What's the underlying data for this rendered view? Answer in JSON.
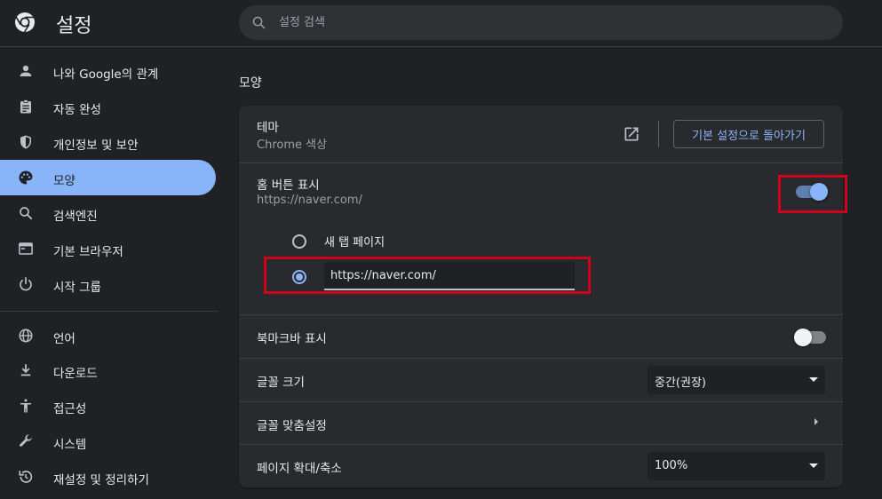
{
  "header": {
    "title": "설정",
    "search_placeholder": "설정 검색"
  },
  "sidebar": {
    "items": [
      {
        "label": "나와 Google의 관계",
        "icon": "person-icon"
      },
      {
        "label": "자동 완성",
        "icon": "clipboard-icon"
      },
      {
        "label": "개인정보 및 보안",
        "icon": "shield-icon"
      },
      {
        "label": "모양",
        "icon": "palette-icon",
        "active": true
      },
      {
        "label": "검색엔진",
        "icon": "search-icon"
      },
      {
        "label": "기본 브라우저",
        "icon": "browser-window-icon"
      },
      {
        "label": "시작 그룹",
        "icon": "power-icon"
      },
      {
        "label": "언어",
        "icon": "globe-icon"
      },
      {
        "label": "다운로드",
        "icon": "download-icon"
      },
      {
        "label": "접근성",
        "icon": "accessibility-icon"
      },
      {
        "label": "시스템",
        "icon": "wrench-icon"
      },
      {
        "label": "재설정 및 정리하기",
        "icon": "history-reset-icon"
      }
    ]
  },
  "main": {
    "section_title": "모양",
    "theme": {
      "title": "테마",
      "subtitle": "Chrome 색상",
      "reset_button": "기본 설정으로 돌아가기"
    },
    "home_button": {
      "title": "홈 버튼 표시",
      "subtitle": "https://naver.com/",
      "enabled": true,
      "options": {
        "new_tab_label": "새 탭 페이지",
        "custom_url_value": "https://naver.com/",
        "selected": "custom"
      }
    },
    "bookmarks_bar": {
      "title": "북마크바 표시",
      "enabled": false
    },
    "font_size": {
      "title": "글꼴 크기",
      "value": "중간(권장)"
    },
    "customize_fonts": {
      "title": "글꼴 맞춤설정"
    },
    "page_zoom": {
      "title": "페이지 확대/축소",
      "value": "100%"
    }
  },
  "colors": {
    "accent": "#8ab4f8",
    "highlight": "#d0021b",
    "background": "#202124",
    "card": "#292a2d"
  }
}
